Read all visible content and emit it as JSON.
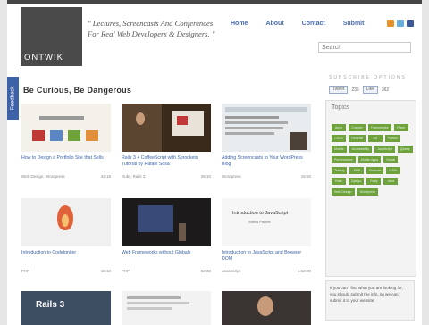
{
  "logo": {
    "text": "ONTWIK"
  },
  "tagline": "\" Lectures, Screencasts And Conferences For Real Web Developers & Designers. \"",
  "nav": [
    "Home",
    "About",
    "Contact",
    "Submit"
  ],
  "search": {
    "placeholder": "Search"
  },
  "feedback_label": "Feedback",
  "heading": "Be Curious, Be Dangerous",
  "subscribe_label": "SUBSCRIBE OPTIONS",
  "share": {
    "tweet": "Tweet",
    "tweet_count": "235",
    "like": "Like",
    "like_count": "362"
  },
  "topics": {
    "title": "Topics",
    "tags": [
      "Apps",
      "Chapter",
      "Frameworks",
      "Flash",
      "CSS3",
      "General",
      "AS",
      "Python",
      "Mobile",
      "Accessibility",
      "JavaScript",
      "jQuery",
      "Performance",
      "Mobile Apps",
      "Social",
      "Testing",
      "PHP",
      "Podcast",
      "HTML",
      "Rails",
      "Django",
      "Ruby",
      "Java",
      "Web Design",
      "Wordpress"
    ]
  },
  "notice": "If you can't find what you are looking for, you should submit the info, so we can submit it to your website.",
  "cards": [
    {
      "title": "How to Design a Portfolio Site that Sells",
      "cat": "Web Design, Wordpress",
      "time": "42:18"
    },
    {
      "title": "Rails 3 + CoffeeScript with Sprockets Tutorial by Rafael Sosa",
      "cat": "Ruby, Rails 3",
      "time": "28:10"
    },
    {
      "title": "Adding Screencasts to Your WordPress Blog",
      "cat": "Wordpress",
      "time": "18:50"
    },
    {
      "title": "Introduction to CodeIgniter",
      "cat": "PHP",
      "time": "15:10"
    },
    {
      "title": "Web Frameworks without Globals",
      "cat": "PHP",
      "time": "52:30"
    },
    {
      "title": "Introduction to JavaScript and Browser DOM",
      "cat": "JavaScript",
      "time": "1:12:00"
    },
    {
      "title": "",
      "cat": "",
      "time": ""
    },
    {
      "title": "",
      "cat": "",
      "time": ""
    },
    {
      "title": "",
      "cat": "",
      "time": ""
    }
  ],
  "thumb_texts": {
    "js": "Introduction to JavaScript",
    "js_sub": "Wilfrid Palmer",
    "rails": "Rails 3"
  }
}
